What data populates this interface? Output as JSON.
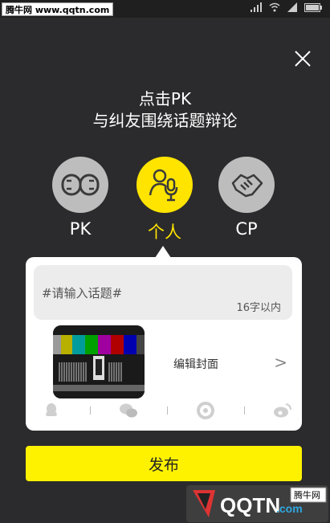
{
  "statusbar": {
    "watermark_text": "腾牛网 www.qqtn.com"
  },
  "headline": {
    "line1": "点击PK",
    "line2": "与纠友围绕话题辩论"
  },
  "modes": [
    {
      "label": "PK",
      "icon": "pk-gloves-icon",
      "active": false
    },
    {
      "label": "个人",
      "icon": "microphone-person-icon",
      "active": true
    },
    {
      "label": "CP",
      "icon": "handshake-icon",
      "active": false
    }
  ],
  "topic": {
    "placeholder": "#请输入话题#",
    "char_limit": "16字以内"
  },
  "cover": {
    "edit_label": "编辑封面",
    "chevron": ">"
  },
  "share": [
    "qq-icon",
    "wechat-icon",
    "moments-icon",
    "weibo-icon"
  ],
  "publish": {
    "label": "发布"
  },
  "watermark": {
    "logo_text": "QQTN",
    "domain": ".com",
    "tag": "腾牛网"
  },
  "colors": {
    "background": "#2b2b2d",
    "accent_yellow": "#ffe400",
    "inactive_circle": "#bdbdbd"
  }
}
